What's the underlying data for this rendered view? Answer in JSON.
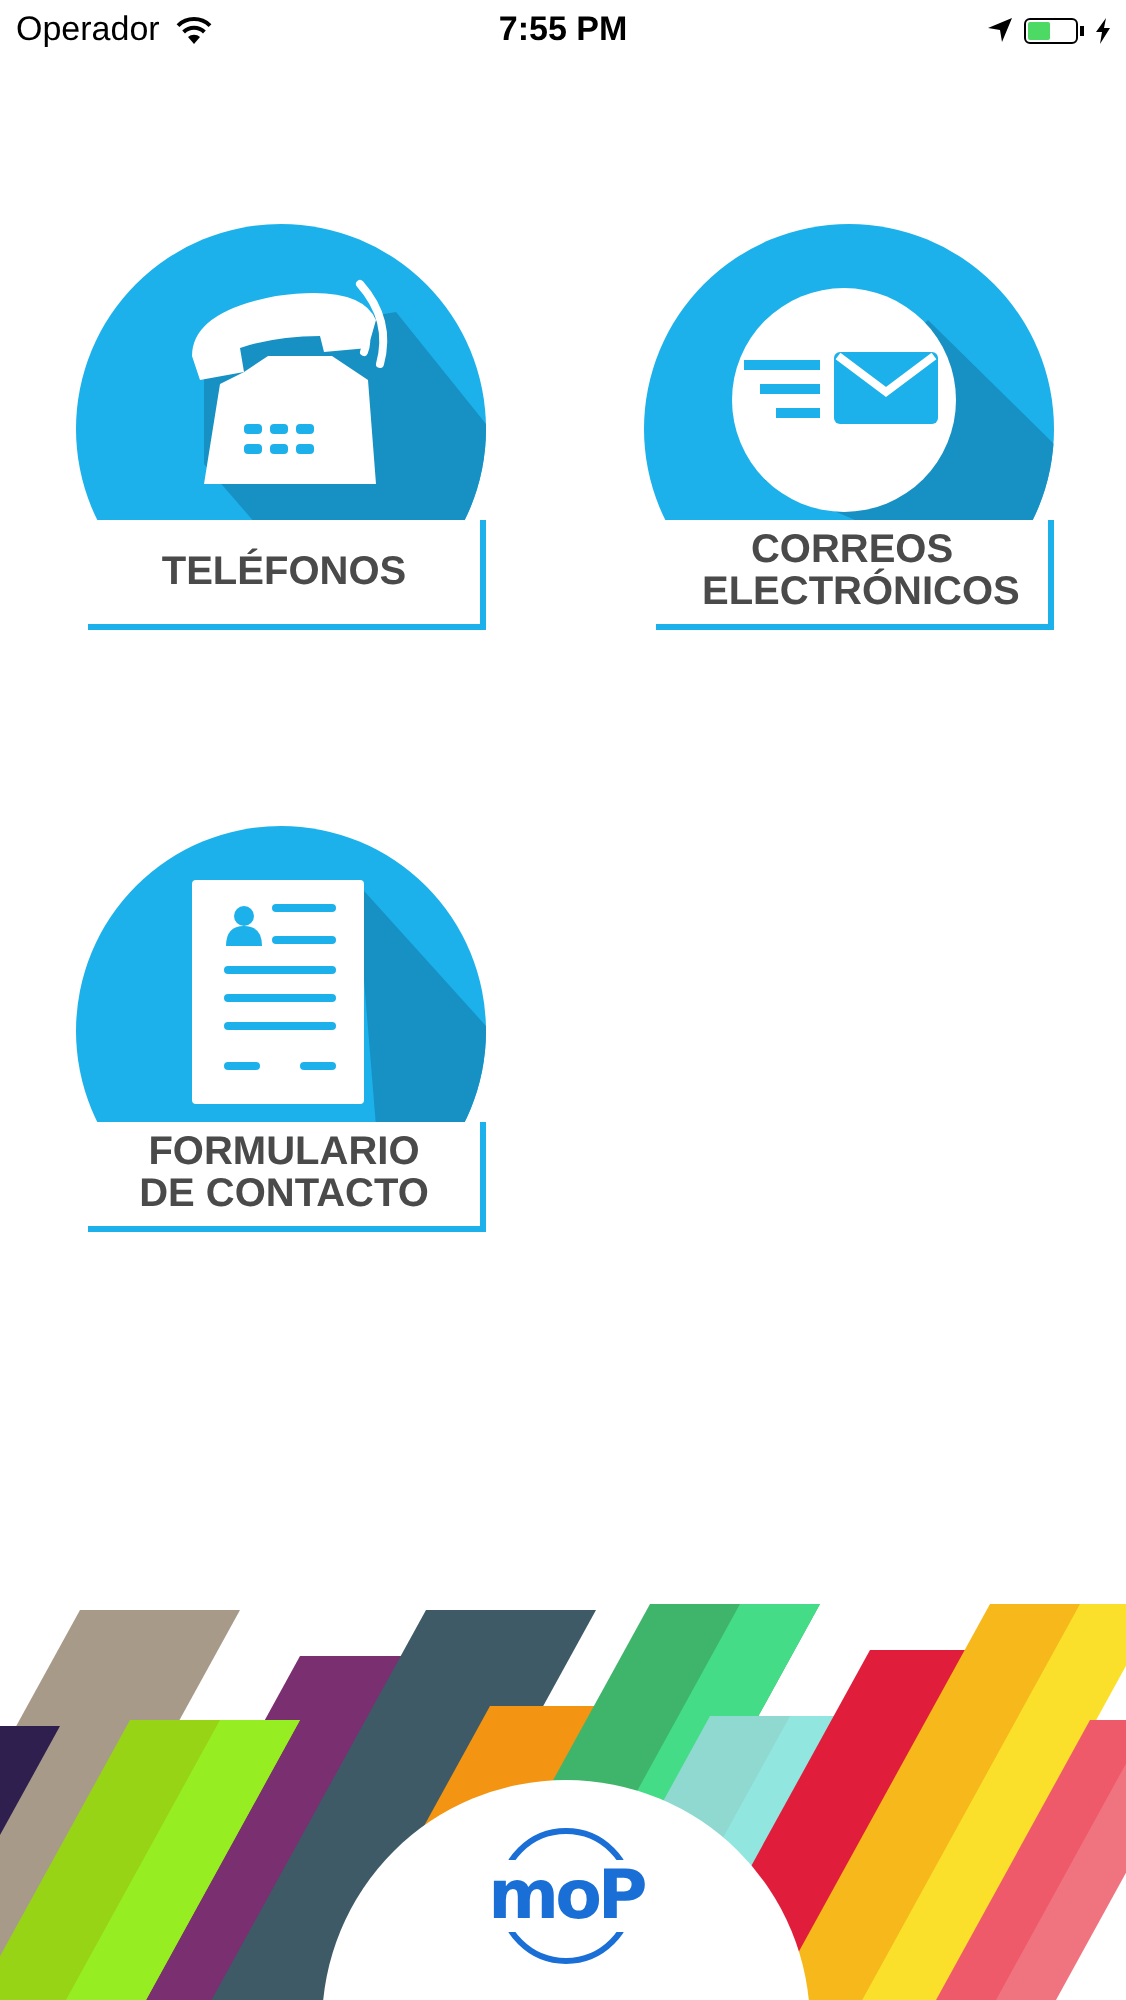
{
  "status_bar": {
    "carrier": "Operador",
    "time": "7:55 PM"
  },
  "menu": [
    {
      "kind": "phone",
      "label": "TELÉFONOS"
    },
    {
      "kind": "mail",
      "label": "CORREOS ELECTRÓNICOS"
    },
    {
      "kind": "form",
      "label": "FORMULARIO DE CONTACTO"
    }
  ],
  "footer": {
    "logo": "moP"
  }
}
